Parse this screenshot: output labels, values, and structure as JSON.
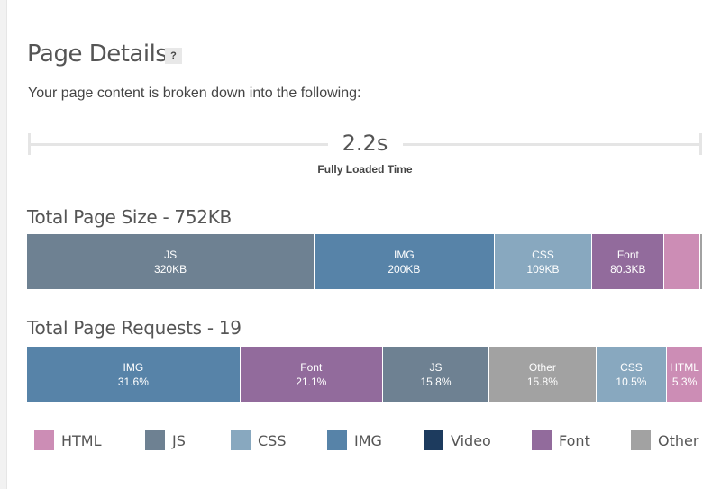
{
  "header": {
    "title": "Page Details",
    "help_label": "?",
    "subtitle": "Your page content is broken down into the following:"
  },
  "timeline": {
    "value": "2.2s",
    "label": "Fully Loaded Time"
  },
  "colors": {
    "HTML": "#cc8db5",
    "JS": "#6e8192",
    "CSS": "#88a8bf",
    "IMG": "#5783a8",
    "Video": "#1d3b5e",
    "Font": "#926b9c",
    "Other": "#a2a2a2"
  },
  "chart_data": [
    {
      "type": "bar",
      "orientation": "stacked-horizontal",
      "title": "Total Page Size - 752KB",
      "unit": "KB",
      "total": 752,
      "categories": [
        "JS",
        "IMG",
        "CSS",
        "Font",
        "HTML",
        "Other"
      ],
      "values": [
        320,
        200,
        109,
        80.3,
        40,
        2.7
      ],
      "labels": [
        {
          "name": "JS",
          "value": "320KB"
        },
        {
          "name": "IMG",
          "value": "200KB"
        },
        {
          "name": "CSS",
          "value": "109KB"
        },
        {
          "name": "Font",
          "value": "80.3KB"
        },
        {
          "name": "HTML",
          "value": ""
        },
        {
          "name": "Other",
          "value": ""
        }
      ]
    },
    {
      "type": "bar",
      "orientation": "stacked-horizontal",
      "title": "Total Page Requests - 19",
      "unit": "%",
      "total": 19,
      "categories": [
        "IMG",
        "Font",
        "JS",
        "Other",
        "CSS",
        "HTML"
      ],
      "values": [
        31.6,
        21.1,
        15.8,
        15.8,
        10.5,
        5.3
      ],
      "labels": [
        {
          "name": "IMG",
          "value": "31.6%"
        },
        {
          "name": "Font",
          "value": "21.1%"
        },
        {
          "name": "JS",
          "value": "15.8%"
        },
        {
          "name": "Other",
          "value": "15.8%"
        },
        {
          "name": "CSS",
          "value": "10.5%"
        },
        {
          "name": "HTML",
          "value": "5.3%"
        }
      ]
    }
  ],
  "legend": [
    "HTML",
    "JS",
    "CSS",
    "IMG",
    "Video",
    "Font",
    "Other"
  ]
}
